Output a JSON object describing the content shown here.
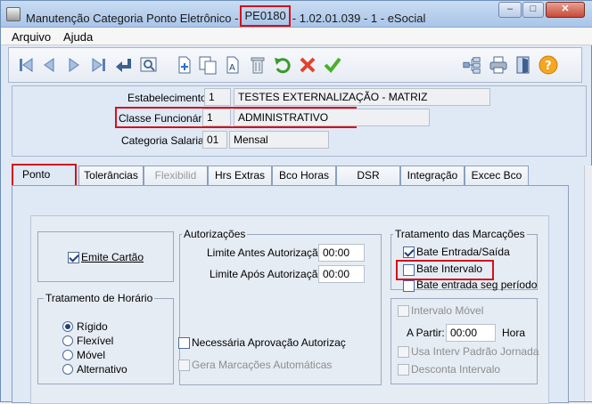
{
  "window": {
    "title_prefix": "Manutenção Categoria Ponto Eletrônico - ",
    "title_code": "PE0180",
    "title_suffix": " - 1.02.01.039 - 1 - eSocial",
    "controls": {
      "minimize": "–",
      "maximize": "□",
      "close": "✕"
    }
  },
  "menu": {
    "items": [
      "Arquivo",
      "Ajuda"
    ]
  },
  "toolbar": {
    "icons": [
      "first-icon",
      "previous-icon",
      "next-icon",
      "last-icon",
      "return-icon",
      "zoom-icon",
      "new-icon",
      "copy-icon",
      "edit-icon",
      "delete-icon",
      "undo-icon",
      "cancel-icon",
      "confirm-icon",
      "tree-icon",
      "print-icon",
      "exit-icon",
      "help-icon"
    ]
  },
  "header": {
    "estabelecimento": {
      "label": "Estabelecimento:",
      "code": "1",
      "name": "TESTES EXTERNALIZAÇÃO - MATRIZ"
    },
    "classe": {
      "label": "Classe Funcionário:",
      "code": "1",
      "name": "ADMINISTRATIVO"
    },
    "categoria": {
      "label": "Categoria Salarial:",
      "code": "01",
      "name": "Mensal"
    }
  },
  "tabs": [
    "Ponto",
    "Tolerâncias",
    "Flexibilid",
    "Hrs Extras",
    "Bco Horas",
    "DSR",
    "Integração",
    "Excec Bco"
  ],
  "ponto": {
    "emite_cartao": {
      "label": "Emite Cartão",
      "checked": true
    },
    "tratamento_horario": {
      "title": "Tratamento de Horário",
      "options": [
        "Rígido",
        "Flexível",
        "Móvel",
        "Alternativo"
      ],
      "selected": "Rígido"
    },
    "autorizacoes": {
      "title": "Autorizações",
      "limite_antes_label": "Limite Antes Autorização:",
      "limite_antes_value": "00:00",
      "limite_apos_label": "Limite Após Autorização:",
      "limite_apos_value": "00:00",
      "necessaria_aprovacao": "Necessária Aprovação Autorizaç",
      "gera_marcacoes": "Gera Marcações Automáticas"
    },
    "tratamento_marcacoes": {
      "title": "Tratamento das Marcações",
      "bate_entrada_saida": "Bate Entrada/Saída",
      "bate_intervalo": "Bate Intervalo",
      "bate_entrada_seg": "Bate entrada seg período",
      "intervalo_movel": "Intervalo Móvel",
      "a_partir_label": "A Partir:",
      "a_partir_value": "00:00",
      "hora_label": "Hora",
      "usa_interv_padrao": "Usa Interv Padrão Jornada",
      "desconta_intervalo": "Desconta Intervalo"
    }
  }
}
